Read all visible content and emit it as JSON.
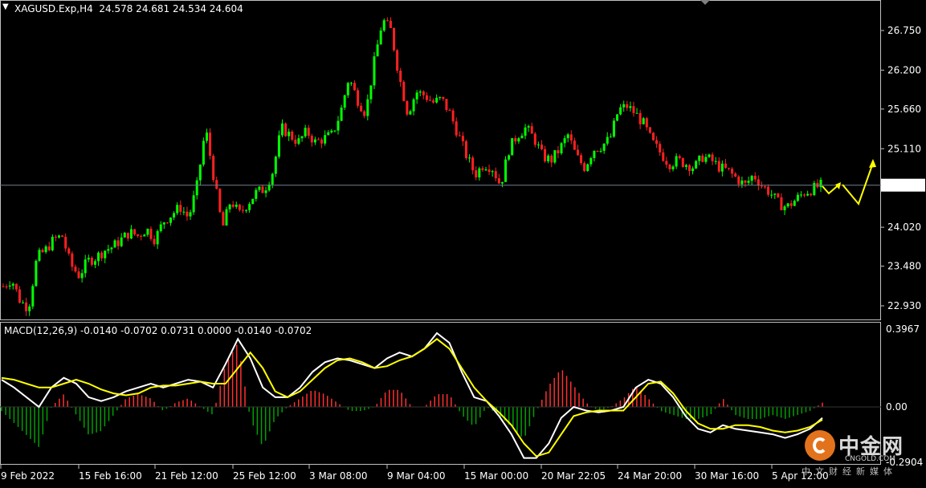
{
  "colors": {
    "bull": "#00ff00",
    "bear": "#ff2020",
    "signal": "#ffff00",
    "macd": "#ffffff",
    "hist_pos": "#ff3030",
    "hist_neg": "#00a000",
    "axis": "#ffffff",
    "price_line": "#708090"
  },
  "header": {
    "menu_icon": "dropdown-triangle-icon",
    "title": "XAGUSD.Exp,H4  24.578 24.681 24.534 24.604"
  },
  "macd_header": {
    "title": "MACD(12,26,9) -0.0140 -0.0702 0.0731 0.0000 -0.0140 -0.0702"
  },
  "price_axis": {
    "labels": [
      "26.750",
      "26.200",
      "25.660",
      "25.110",
      "24.604",
      "24.020",
      "23.480",
      "22.930"
    ]
  },
  "macd_axis": {
    "labels": [
      "0.3967",
      "0.00",
      "-0.2904"
    ]
  },
  "time_axis": {
    "labels": [
      "9 Feb 2022",
      "15 Feb 16:00",
      "21 Feb 12:00",
      "25 Feb 12:00",
      "3 Mar 08:00",
      "9 Mar 04:00",
      "15 Mar 00:00",
      "20 Mar 22:05",
      "24 Mar 20:00",
      "30 Mar 16:00",
      "5 Apr 12:00"
    ]
  },
  "logo": {
    "name": "中金网",
    "url_text": "CNGOLD.COM",
    "tagline": "中文财经新媒体",
    "icon": "cngold-logo-icon"
  },
  "chart_data": [
    {
      "type": "candlestick",
      "title": "XAGUSD.Exp,H4",
      "ohlc_last": {
        "open": 24.578,
        "high": 24.681,
        "low": 24.534,
        "close": 24.604
      },
      "current_price": 24.604,
      "ylim": [
        22.73,
        27.2
      ],
      "yticks": [
        26.75,
        26.2,
        25.66,
        25.11,
        24.604,
        24.02,
        23.48,
        22.93
      ],
      "x_tick_labels": [
        "9 Feb 2022",
        "15 Feb 16:00",
        "21 Feb 12:00",
        "25 Feb 12:00",
        "3 Mar 08:00",
        "9 Mar 04:00",
        "15 Mar 00:00",
        "20 Mar 22:05",
        "24 Mar 20:00",
        "30 Mar 16:00",
        "5 Apr 12:00"
      ],
      "close_path": [
        23.2,
        23.3,
        23.0,
        22.9,
        23.6,
        23.7,
        23.85,
        23.9,
        23.5,
        23.35,
        23.55,
        23.6,
        23.7,
        23.75,
        23.85,
        23.95,
        23.9,
        24.0,
        23.85,
        24.1,
        24.2,
        24.3,
        24.15,
        24.6,
        25.4,
        24.7,
        24.0,
        24.4,
        24.2,
        24.35,
        24.5,
        24.55,
        24.8,
        25.4,
        25.3,
        25.2,
        25.35,
        25.2,
        25.25,
        25.3,
        25.6,
        26.1,
        25.8,
        25.6,
        26.3,
        26.9,
        26.75,
        26.1,
        25.6,
        25.9,
        25.85,
        25.75,
        25.8,
        25.6,
        25.3,
        25.0,
        24.75,
        24.9,
        24.85,
        24.6,
        25.1,
        25.3,
        25.4,
        25.25,
        25.0,
        24.95,
        25.1,
        25.3,
        25.0,
        24.85,
        25.1,
        25.15,
        25.25,
        25.65,
        25.7,
        25.6,
        25.45,
        25.2,
        25.05,
        24.9,
        24.95,
        24.9,
        24.85,
        25.0,
        24.95,
        24.85,
        24.8,
        24.7,
        24.6,
        24.75,
        24.6,
        24.5,
        24.35,
        24.3,
        24.4,
        24.5,
        24.55,
        24.6
      ]
    },
    {
      "type": "line",
      "title": "MACD(12,26,9)",
      "values_shown": [
        -0.014,
        -0.0702,
        0.0731,
        0.0,
        -0.014,
        -0.0702
      ],
      "ylim": [
        -0.2904,
        0.3967
      ],
      "yticks": [
        0.3967,
        0.0,
        -0.2904
      ],
      "series": [
        {
          "color": "#ffffff",
          "values": [
            0.14,
            0.1,
            0.05,
            0.0,
            0.1,
            0.15,
            0.12,
            0.05,
            0.03,
            0.05,
            0.08,
            0.1,
            0.12,
            0.1,
            0.12,
            0.14,
            0.13,
            0.1,
            0.22,
            0.35,
            0.25,
            0.1,
            0.05,
            0.05,
            0.1,
            0.18,
            0.23,
            0.25,
            0.24,
            0.22,
            0.2,
            0.25,
            0.28,
            0.26,
            0.3,
            0.38,
            0.33,
            0.18,
            0.05,
            0.03,
            -0.05,
            -0.15,
            -0.28,
            -0.28,
            -0.2,
            -0.06,
            0.0,
            -0.02,
            -0.03,
            -0.02,
            0.0,
            0.1,
            0.14,
            0.12,
            0.05,
            -0.05,
            -0.12,
            -0.14,
            -0.1,
            -0.12,
            -0.13,
            -0.14,
            -0.15,
            -0.17,
            -0.15,
            -0.12,
            -0.06
          ]
        },
        {
          "color": "#ffff00",
          "values": [
            0.15,
            0.14,
            0.12,
            0.1,
            0.1,
            0.12,
            0.14,
            0.12,
            0.09,
            0.07,
            0.06,
            0.07,
            0.1,
            0.11,
            0.11,
            0.12,
            0.13,
            0.12,
            0.12,
            0.2,
            0.28,
            0.2,
            0.08,
            0.05,
            0.08,
            0.14,
            0.2,
            0.24,
            0.25,
            0.23,
            0.2,
            0.21,
            0.24,
            0.26,
            0.3,
            0.35,
            0.3,
            0.2,
            0.1,
            0.03,
            -0.03,
            -0.1,
            -0.2,
            -0.27,
            -0.25,
            -0.15,
            -0.05,
            -0.03,
            -0.02,
            -0.02,
            -0.02,
            0.05,
            0.12,
            0.13,
            0.07,
            -0.02,
            -0.09,
            -0.12,
            -0.12,
            -0.1,
            -0.1,
            -0.11,
            -0.13,
            -0.14,
            -0.13,
            -0.11,
            -0.07
          ]
        }
      ]
    }
  ]
}
